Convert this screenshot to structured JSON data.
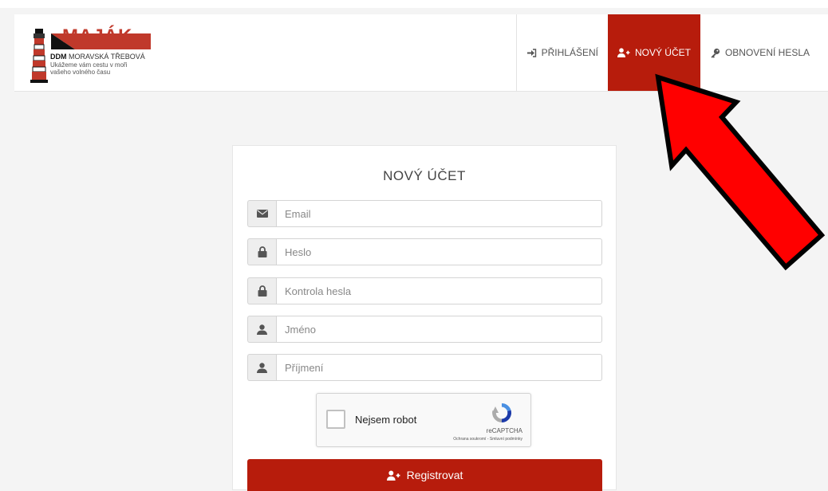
{
  "header": {
    "logo": {
      "word": "MAJÁK",
      "org_bold": "DDM",
      "org_light": "MORAVSKÁ TŘEBOVÁ",
      "tagline": "Ukážeme vám cestu v moři vašeho volného času"
    },
    "nav": [
      {
        "label": "PŘIHLÁŠENÍ",
        "icon": "sign-in-icon",
        "active": false
      },
      {
        "label": "NOVÝ ÚČET",
        "icon": "user-plus-icon",
        "active": true
      },
      {
        "label": "OBNOVENÍ HESLA",
        "icon": "key-icon",
        "active": false
      }
    ]
  },
  "form": {
    "title": "NOVÝ ÚČET",
    "fields": [
      {
        "placeholder": "Email",
        "icon": "envelope-icon",
        "value": ""
      },
      {
        "placeholder": "Heslo",
        "icon": "lock-icon",
        "value": ""
      },
      {
        "placeholder": "Kontrola hesla",
        "icon": "lock-icon",
        "value": ""
      },
      {
        "placeholder": "Jméno",
        "icon": "user-icon",
        "value": ""
      },
      {
        "placeholder": "Příjmení",
        "icon": "user-icon",
        "value": ""
      }
    ],
    "captcha": {
      "label": "Nejsem robot",
      "brand": "reCAPTCHA",
      "links": "Ochrana soukromí - Smluvní podmínky",
      "checked": false
    },
    "submit_label": "Registrovat"
  },
  "colors": {
    "accent": "#b71c0c",
    "annotation_arrow": "#ff0000"
  },
  "annotation": {
    "icon": "red-arrow-icon"
  }
}
